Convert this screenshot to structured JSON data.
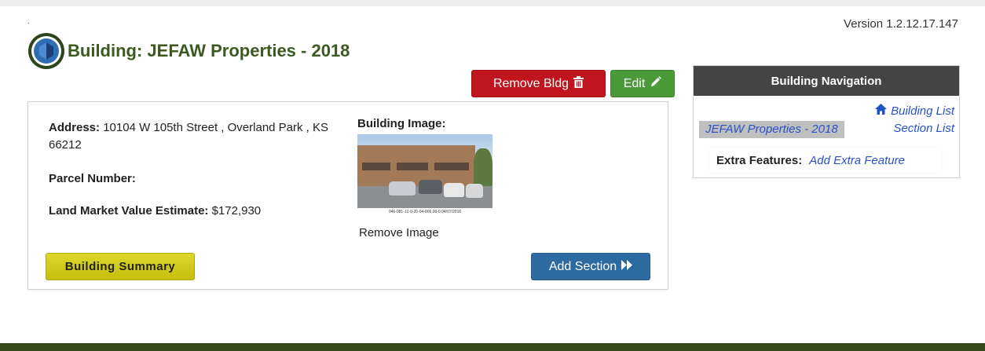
{
  "version": "Version 1.2.12.17.147",
  "page": {
    "title": "Building: JEFAW Properties - 2018",
    "corner_mark": "."
  },
  "toolbar": {
    "remove_label": "Remove Bldg",
    "remove_icon": "trash-icon",
    "edit_label": "Edit",
    "edit_icon": "pencil-icon"
  },
  "details": {
    "address_label": "Address:",
    "address_value": "10104 W 105th Street , Overland Park , KS 66212",
    "parcel_label": "Parcel Number:",
    "parcel_value": "",
    "land_label": "Land Market Value Estimate:",
    "land_value": "$172,930",
    "image_label": "Building Image:",
    "image_caption": "046-081-12-0-20-04-006.00-0  04/07/2016",
    "remove_image": "Remove Image"
  },
  "actions": {
    "summary_label": "Building Summary",
    "add_section_label": "Add Section",
    "add_section_icon": "double-chevron-right-icon"
  },
  "navigation": {
    "header": "Building Navigation",
    "building_list": "Building List",
    "building_list_icon": "home-icon",
    "current_building": "JEFAW Properties - 2018",
    "section_list": "Section List",
    "extra_features_label": "Extra Features:",
    "add_extra_feature": "Add Extra Feature"
  },
  "colors": {
    "title_green": "#3b5a20",
    "remove_red": "#c0151c",
    "edit_green": "#4a9a3a",
    "summary_yellow": "#d0c918",
    "add_section_blue": "#2c6aa0",
    "nav_header": "#444444",
    "link_blue": "#2a52c9",
    "footer": "#344a1c"
  }
}
